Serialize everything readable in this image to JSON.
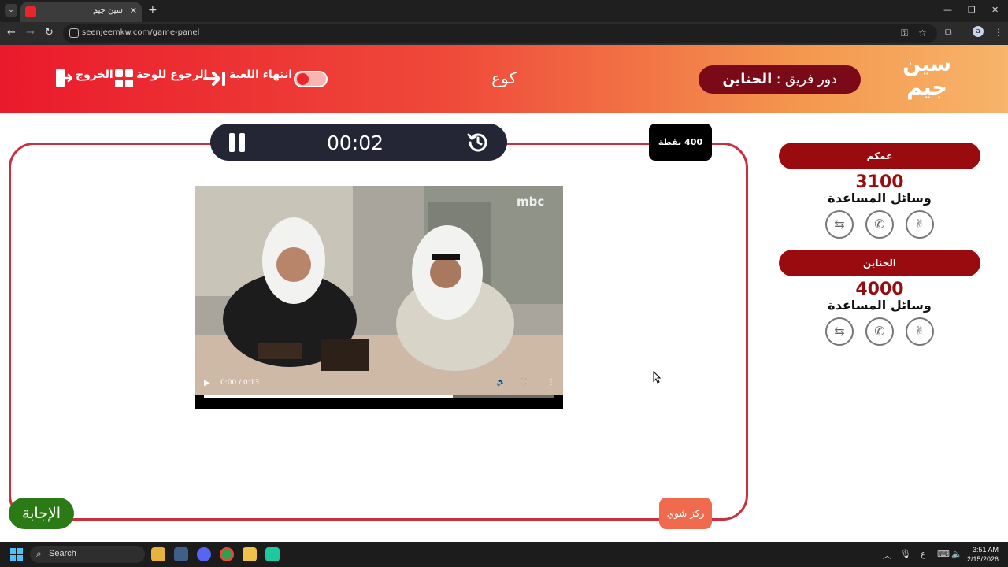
{
  "browser": {
    "tab_title": "سين جيم",
    "url": "seenjeemkw.com/game-panel"
  },
  "header": {
    "logo_text": "سين جيم",
    "turn_prefix": "دور فريق :",
    "turn_team": "الحناين",
    "question_word": "كوع",
    "end_game_label": "انتهاء اللعبة",
    "back_to_board_label": "الرجوع للوحة",
    "exit_label": "الخروج"
  },
  "teams": [
    {
      "name": "عمكم",
      "score": "3100",
      "aids_title": "وسائل المساعدة",
      "aids": [
        "two-hands-icon",
        "phone-icon",
        "peace-hand-icon"
      ]
    },
    {
      "name": "الحناين",
      "score": "4000",
      "aids_title": "وسائل المساعدة",
      "aids": [
        "two-hands-icon",
        "phone-icon",
        "peace-hand-icon"
      ]
    }
  ],
  "game": {
    "timer": "00:02",
    "points_label": "400 نقطة",
    "video_time": "0:00 / 0:13",
    "video_progress": 0.71,
    "hint_label": "ركز شوي",
    "answer_label": "الإجابة",
    "video_watermark": "mbc"
  },
  "taskbar": {
    "search_label": "Search",
    "lang": "ع",
    "time": "3:51 AM",
    "date": "2/15/2026"
  }
}
